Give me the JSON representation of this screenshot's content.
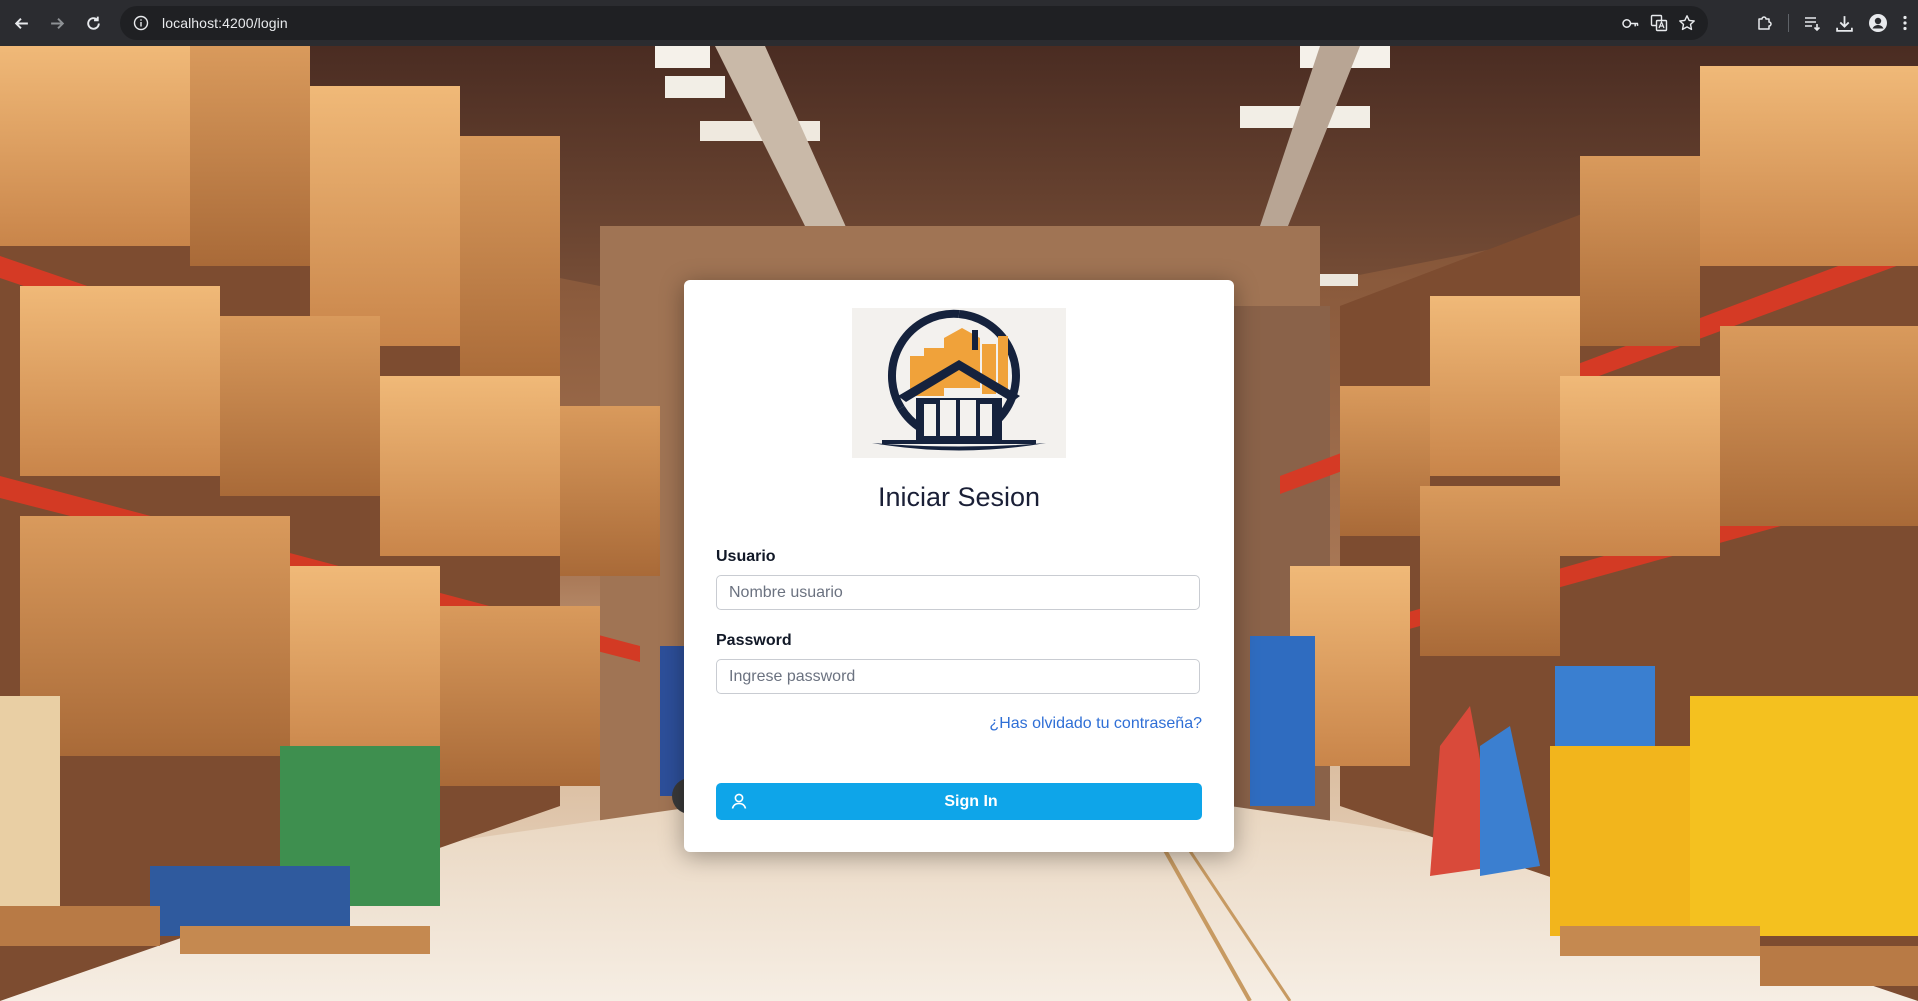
{
  "browser": {
    "url": "localhost:4200/login"
  },
  "login": {
    "title": "Iniciar Sesion",
    "username_label": "Usuario",
    "username_placeholder": "Nombre usuario",
    "password_label": "Password",
    "password_placeholder": "Ingrese password",
    "forgot_link": "¿Has olvidado tu contraseña?",
    "signin_label": "Sign In"
  },
  "colors": {
    "primary_button": "#0ea5e9",
    "link": "#2f6fd6",
    "logo_navy": "#15223d",
    "logo_orange": "#f0a23a"
  },
  "icons": {
    "back": "arrow-left-icon",
    "forward": "arrow-right-icon",
    "reload": "reload-icon",
    "site_info": "info-icon",
    "password_key": "key-icon",
    "translate": "translate-icon",
    "bookmark": "star-icon",
    "extensions": "puzzle-icon",
    "reading_list": "reading-list-icon",
    "downloads": "download-icon",
    "profile": "profile-icon",
    "menu": "kebab-menu-icon",
    "signin_user": "user-icon"
  }
}
